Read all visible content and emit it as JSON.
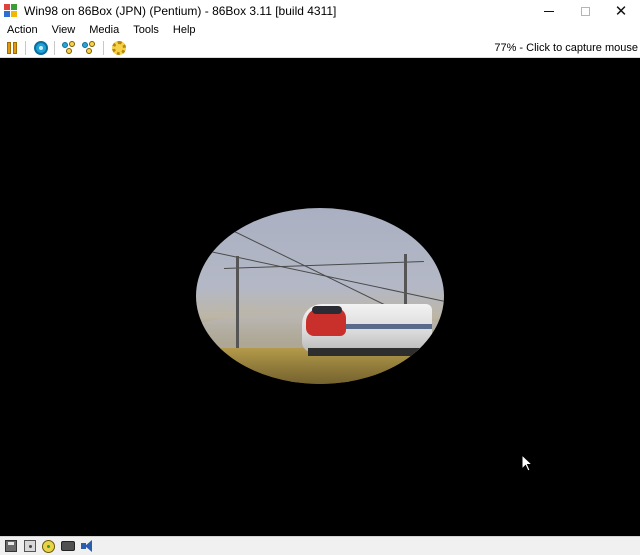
{
  "window": {
    "title": "Win98 on 86Box (JPN) (Pentium) - 86Box 3.11 [build 4311]",
    "app_icon": "86box-app-icon"
  },
  "title_controls": {
    "minimize_icon": "minimize-icon",
    "maximize_icon": "maximize-icon",
    "close_glyph": "✕"
  },
  "menu": {
    "items": [
      {
        "label": "Action"
      },
      {
        "label": "View"
      },
      {
        "label": "Media"
      },
      {
        "label": "Tools"
      },
      {
        "label": "Help"
      }
    ]
  },
  "toolbar": {
    "buttons": [
      {
        "icon": "pause-icon"
      },
      {
        "icon": "hard-reset-icon"
      },
      {
        "icon": "ctrl-alt-del-icon"
      },
      {
        "icon": "ctrl-alt-esc-icon"
      },
      {
        "icon": "settings-icon"
      }
    ],
    "status_message": "77% - Click to capture mouse"
  },
  "screen": {
    "content": "video-playback",
    "background": "#000000"
  },
  "statusbar": {
    "icons": [
      {
        "icon": "floppy-525-icon"
      },
      {
        "icon": "floppy-35-icon"
      },
      {
        "icon": "cdrom-icon"
      },
      {
        "icon": "hard-disk-icon"
      },
      {
        "icon": "sound-icon"
      }
    ]
  },
  "colors": {
    "pause_accent": "#e09a12",
    "reset_accent": "#1fa2d6",
    "screen_bg": "#000000",
    "statusbar_bg": "#f0f0f0"
  }
}
